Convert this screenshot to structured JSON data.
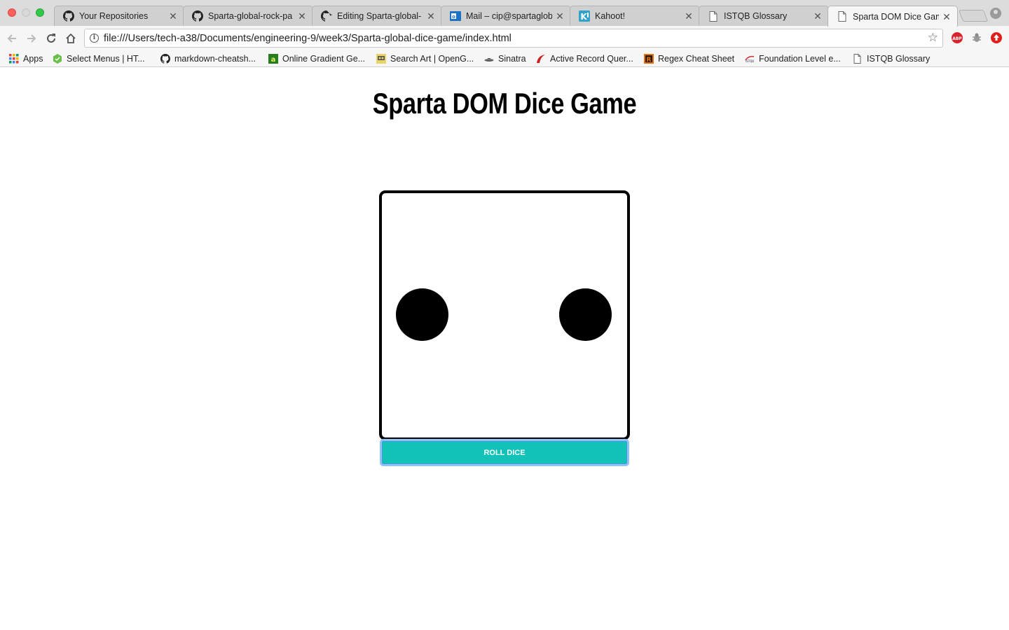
{
  "browser": {
    "tabs": [
      {
        "title": "Your Repositories",
        "icon": "github-icon"
      },
      {
        "title": "Sparta-global-rock-pa",
        "icon": "github-icon"
      },
      {
        "title": "Editing Sparta-global-",
        "icon": "github-icon"
      },
      {
        "title": "Mail – cip@spartagloba",
        "icon": "outlook-icon"
      },
      {
        "title": "Kahoot!",
        "icon": "kahoot-icon"
      },
      {
        "title": "ISTQB Glossary",
        "icon": "page-icon"
      },
      {
        "title": "Sparta DOM Dice Game",
        "icon": "page-icon"
      }
    ],
    "url": "file:///Users/tech-a38/Documents/engineering-9/week3/Sparta-global-dice-game/index.html",
    "bookmarks": [
      {
        "label": "Apps",
        "icon": "apps-grid-icon"
      },
      {
        "label": "Select Menus | HT...",
        "icon": "leaf-icon"
      },
      {
        "label": "markdown-cheatsh...",
        "icon": "github-icon"
      },
      {
        "label": "Online Gradient Ge...",
        "icon": "gradient-icon"
      },
      {
        "label": "Search Art | OpenG...",
        "icon": "opengameart-icon"
      },
      {
        "label": "Sinatra",
        "icon": "sinatra-icon"
      },
      {
        "label": "Active Record Quer...",
        "icon": "rails-icon"
      },
      {
        "label": "Regex Cheat Sheet",
        "icon": "regex-icon"
      },
      {
        "label": "Foundation Level e...",
        "icon": "istqb-icon"
      },
      {
        "label": "ISTQB Glossary",
        "icon": "page-icon"
      }
    ]
  },
  "page": {
    "heading": "Sparta DOM Dice Game",
    "die_value": 2,
    "roll_button": "ROLL DICE"
  },
  "colors": {
    "button": "#12c2b8",
    "button_focus": "#8ec4f4",
    "pip": "#000000"
  }
}
